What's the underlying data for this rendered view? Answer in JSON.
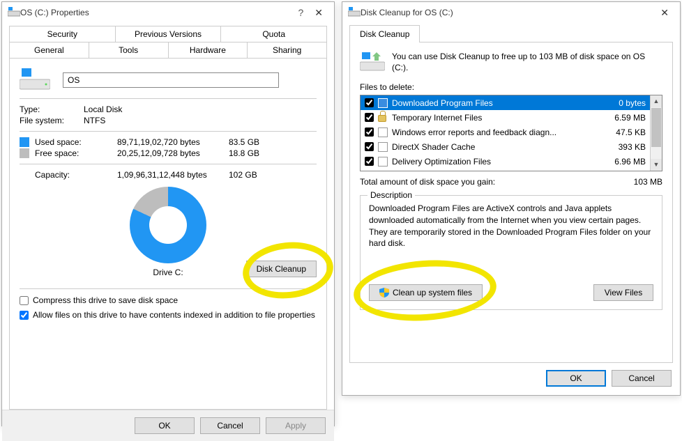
{
  "props": {
    "title": "OS (C:) Properties",
    "tabs_upper": [
      "Security",
      "Previous Versions",
      "Quota"
    ],
    "tabs_lower": [
      "General",
      "Tools",
      "Hardware",
      "Sharing"
    ],
    "drive_name": "OS",
    "type_label": "Type:",
    "type_value": "Local Disk",
    "fs_label": "File system:",
    "fs_value": "NTFS",
    "used_label": "Used space:",
    "used_bytes": "89,71,19,02,720 bytes",
    "used_h": "83.5 GB",
    "free_label": "Free space:",
    "free_bytes": "20,25,12,09,728 bytes",
    "free_h": "18.8 GB",
    "cap_label": "Capacity:",
    "cap_bytes": "1,09,96,31,12,448 bytes",
    "cap_h": "102 GB",
    "drive_caption": "Drive C:",
    "disk_cleanup_btn": "Disk Cleanup",
    "compress_label": "Compress this drive to save disk space",
    "index_label": "Allow files on this drive to have contents indexed in addition to file properties",
    "ok": "OK",
    "cancel": "Cancel",
    "apply": "Apply"
  },
  "dc": {
    "title": "Disk Cleanup for OS (C:)",
    "tab": "Disk Cleanup",
    "info": "You can use Disk Cleanup to free up to 103 MB of disk space on OS (C:).",
    "files_to_delete": "Files to delete:",
    "items": [
      {
        "name": "Downloaded Program Files",
        "size": "0 bytes",
        "checked": true,
        "selected": true,
        "icon": "folder"
      },
      {
        "name": "Temporary Internet Files",
        "size": "6.59 MB",
        "checked": true,
        "selected": false,
        "icon": "lock"
      },
      {
        "name": "Windows error reports and feedback diagn...",
        "size": "47.5 KB",
        "checked": true,
        "selected": false,
        "icon": "file"
      },
      {
        "name": "DirectX Shader Cache",
        "size": "393 KB",
        "checked": true,
        "selected": false,
        "icon": "file"
      },
      {
        "name": "Delivery Optimization Files",
        "size": "6.96 MB",
        "checked": true,
        "selected": false,
        "icon": "file"
      }
    ],
    "total_label": "Total amount of disk space you gain:",
    "total_value": "103 MB",
    "desc_legend": "Description",
    "desc_text": "Downloaded Program Files are ActiveX controls and Java applets downloaded automatically from the Internet when you view certain pages. They are temporarily stored in the Downloaded Program Files folder on your hard disk.",
    "clean_sys_btn": "Clean up system files",
    "view_files_btn": "View Files",
    "ok": "OK",
    "cancel": "Cancel"
  }
}
